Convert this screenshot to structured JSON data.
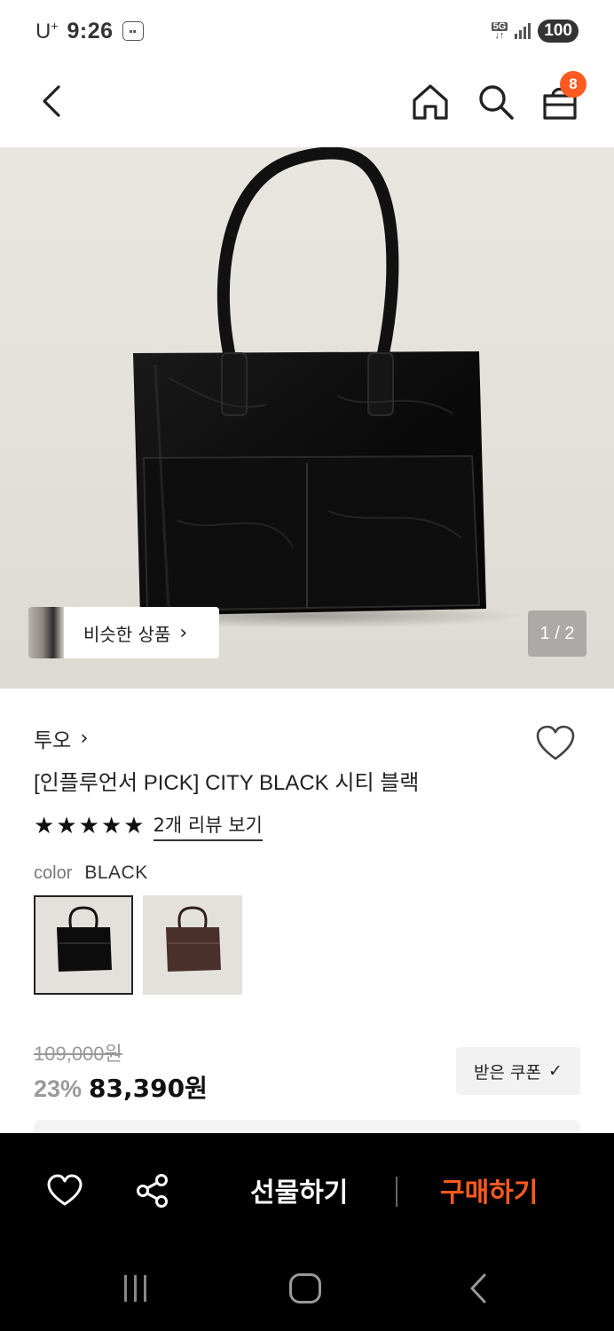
{
  "status": {
    "carrier": "U",
    "carrier_sup": "+",
    "time": "9:26",
    "network": "5G",
    "battery": "100"
  },
  "header": {
    "cart_count": "8",
    "icons": [
      "back-icon",
      "home-icon",
      "search-icon",
      "shopping-bag-icon"
    ]
  },
  "gallery": {
    "similar_label": "비슷한 상품",
    "similar_chevron": "›",
    "counter": "1 / 2"
  },
  "product": {
    "brand": "투오",
    "brand_chevron": "›",
    "title": "[인플루언서 PICK] CITY BLACK 시티 블랙",
    "rating_stars": 5,
    "review_link": "2개 리뷰 보기",
    "color_label": "color",
    "color_value": "BLACK",
    "swatches": [
      {
        "name": "black",
        "color": "#111111",
        "selected": true
      },
      {
        "name": "brown",
        "color": "#4a302a",
        "selected": false
      }
    ],
    "original_price": "109,000원",
    "discount": "23%",
    "sale_price": "83,390원",
    "coupon_label": "받은 쿠폰",
    "coupon_check": "✓"
  },
  "bottom_bar": {
    "gift_label": "선물하기",
    "buy_label": "구매하기",
    "buy_color": "#ff5a1f"
  }
}
